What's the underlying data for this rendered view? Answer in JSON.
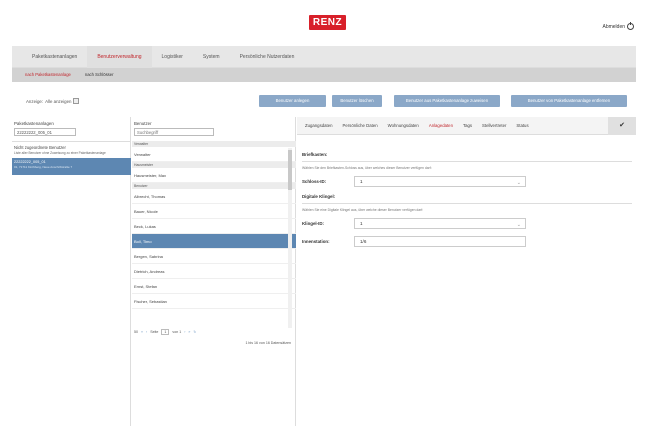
{
  "header": {
    "logo": "RENZ",
    "logout": "Abmelden"
  },
  "nav": {
    "tabs": [
      {
        "label": "Paketkastenanlagen"
      },
      {
        "label": "Benutzerverwaltung"
      },
      {
        "label": "Logistiker"
      },
      {
        "label": "System"
      },
      {
        "label": "Persönliche Nutzerdaten"
      }
    ]
  },
  "subnav": {
    "tabs": [
      {
        "label": "nach Paketkastenanlage"
      },
      {
        "label": "nach Schlösser"
      }
    ]
  },
  "toolbar": {
    "anzeige_label": "Anzeige:",
    "anzeige_value": "Alle anzeigen",
    "buttons": [
      "Benutzer anlegen",
      "Benutzer löschen",
      "Benutzer aus Paketkastenanlage zuweisen",
      "Benutzer von Paketkastenanlage entfernen"
    ]
  },
  "left": {
    "label": "Paketkastenanlagen",
    "input_value": "22222222_005_01",
    "unassigned_title": "Nicht zugeordnete Benutzer",
    "unassigned_sub": "Liste aller Benutzer ohne Zuweisung zu einer Paketkastenanlage",
    "selected_line1": "22222222_005_01",
    "selected_line2": "01, 71711 Kirchberg, Neue Anschrifstraße 7"
  },
  "mid": {
    "label": "Benutzer",
    "placeholder": "Suchbegriff",
    "sec_verwalter": "Verwalter",
    "verwalter": "Verwalter",
    "sec_hausmeister": "Hausmeister",
    "hausmeister": "Hausmeister, Max",
    "sec_benutzer": "Benutzer",
    "users": [
      "Albrecht, Thomas",
      "Bauer, Nicole",
      "Beck, Lukas",
      "Boll, Timo",
      "Bergen, Sabrina",
      "Dietrich, Andreas",
      "Ernst, Stefan",
      "Fischer, Sebastian"
    ],
    "pager": {
      "size": "50",
      "page_label": "Seite",
      "page": "1",
      "of_label": "von 1",
      "count": "1 bis 16 von 16 Datensätzen"
    }
  },
  "right": {
    "tabs": [
      {
        "label": "Zugangsdaten"
      },
      {
        "label": "Persönliche Daten"
      },
      {
        "label": "Wohnungsdaten"
      },
      {
        "label": "Anlagedaten"
      },
      {
        "label": "Tags"
      },
      {
        "label": "Stellvertreter"
      },
      {
        "label": "Status"
      }
    ],
    "brief_head": "Briefkasten:",
    "brief_help": "Wählen Sie den Briefkasten-Schloss aus, über welches dieser Benutzer verfügen darf:",
    "schloss_label": "Schloss-ID:",
    "schloss_value": "1",
    "klingel_head": "Digitale Klingel:",
    "klingel_help": "Wählen Sie eine Digitale Klingel aus, über welche dieser Benutzer verfügen darf:",
    "klingel_label": "Klingel-ID:",
    "klingel_value": "1",
    "innen_label": "Innenstation:",
    "innen_value": "1/6"
  }
}
